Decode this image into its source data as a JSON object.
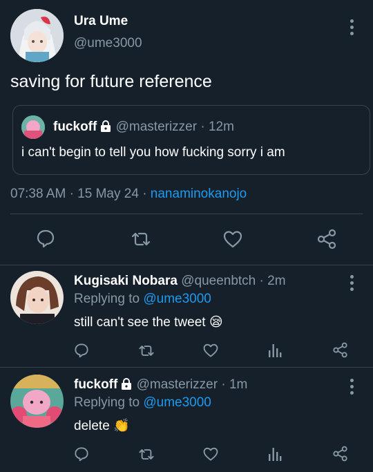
{
  "main_tweet": {
    "display_name": "Ura Ume",
    "handle": "@ume3000",
    "text": "saving for future reference",
    "quote": {
      "display_name": "fuckoff",
      "handle": "@masterizzer",
      "separator": "·",
      "time": "12m",
      "text": "i can't begin to tell you how fucking sorry i am"
    },
    "timestamp": "07:38 AM",
    "date": "15 May 24",
    "source": "nanaminokanojo",
    "separator": "·"
  },
  "replies": [
    {
      "display_name": "Kugisaki Nobara",
      "handle": "@queenbtch",
      "separator": "·",
      "time": "2m",
      "replying_prefix": "Replying to",
      "replying_to": "@ume3000",
      "text": "still can't see the tweet",
      "emoji": "😪"
    },
    {
      "display_name": "fuckoff",
      "handle": "@masterizzer",
      "separator": "·",
      "time": "1m",
      "replying_prefix": "Replying to",
      "replying_to": "@ume3000",
      "text": "delete",
      "emoji": "👏"
    }
  ],
  "colors": {
    "background": "#15202b",
    "muted": "#8899a6",
    "link": "#1d9bf0",
    "divider": "#38444d"
  },
  "icons": [
    "reply-icon",
    "retweet-icon",
    "like-icon",
    "share-icon",
    "analytics-icon",
    "more-icon",
    "lock-icon"
  ]
}
